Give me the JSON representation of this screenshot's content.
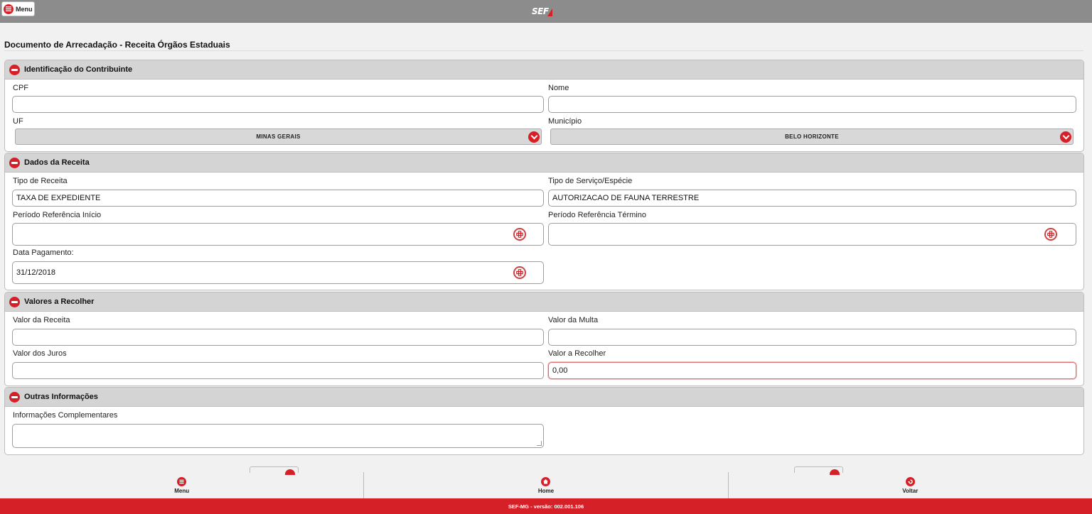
{
  "header": {
    "menu_label": "Menu",
    "logo_text": "SEF"
  },
  "page": {
    "title": "Documento de Arrecadação - Receita Órgãos Estaduais"
  },
  "sections": {
    "contribuinte": {
      "title": "Identificação do Contribuinte",
      "cpf_label": "CPF",
      "cpf_value": "",
      "nome_label": "Nome",
      "nome_value": "",
      "uf_label": "UF",
      "uf_value": "MINAS GERAIS",
      "municipio_label": "Município",
      "municipio_value": "BELO HORIZONTE"
    },
    "receita": {
      "title": "Dados da Receita",
      "tipo_receita_label": "Tipo de Receita",
      "tipo_receita_value": "TAXA DE EXPEDIENTE",
      "tipo_servico_label": "Tipo de Serviço/Espécie",
      "tipo_servico_value": "AUTORIZACAO DE FAUNA TERRESTRE",
      "periodo_inicio_label": "Período Referência Início",
      "periodo_inicio_value": "",
      "periodo_termino_label": "Período Referência Término",
      "periodo_termino_value": "",
      "data_pagamento_label": "Data Pagamento:",
      "data_pagamento_value": "31/12/2018"
    },
    "valores": {
      "title": "Valores a Recolher",
      "valor_receita_label": "Valor da Receita",
      "valor_receita_value": "",
      "valor_multa_label": "Valor da Multa",
      "valor_multa_value": "",
      "valor_juros_label": "Valor dos Juros",
      "valor_juros_value": "",
      "valor_recolher_label": "Valor a Recolher",
      "valor_recolher_value": "0,00"
    },
    "outras": {
      "title": "Outras Informações",
      "complementares_label": "Informações Complementares",
      "complementares_value": ""
    }
  },
  "bottom_nav": {
    "menu": "Menu",
    "home": "Home",
    "voltar": "Voltar"
  },
  "footer": {
    "text": "SEF-MG - versão: 002.001.106"
  },
  "colors": {
    "accent": "#d62027",
    "topbar": "#8c8c8c",
    "panel_head": "#d4d4d4"
  }
}
